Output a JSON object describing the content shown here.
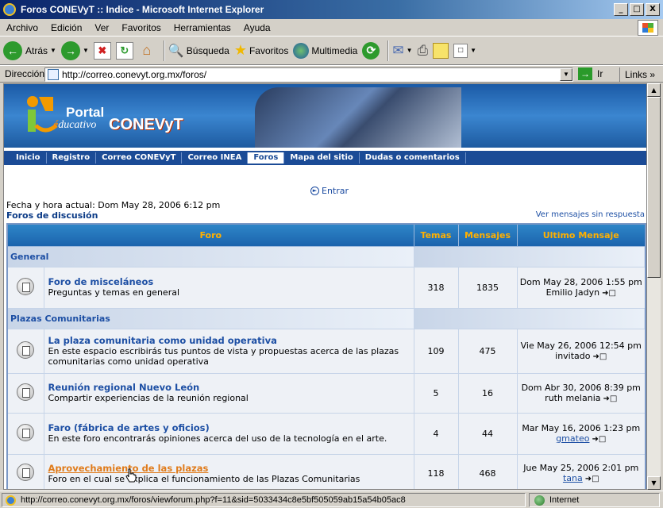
{
  "window": {
    "title": "Foros CONEVyT :: Indice - Microsoft Internet Explorer",
    "buttons": [
      "_",
      "□",
      "X"
    ]
  },
  "menu": [
    "Archivo",
    "Edición",
    "Ver",
    "Favoritos",
    "Herramientas",
    "Ayuda"
  ],
  "toolbar": {
    "back": "Atrás",
    "search": "Búsqueda",
    "favorites": "Favoritos",
    "media": "Multimedia"
  },
  "address": {
    "label": "Dirección",
    "url": "http://correo.conevyt.org.mx/foros/",
    "go": "Ir",
    "links": "Links"
  },
  "banner": {
    "portal": "Portal",
    "educativo": "ducativo",
    "brand": "CONEVyT"
  },
  "nav": [
    "Inicio",
    "Registro",
    "Correo CONEVyT",
    "Correo INEA",
    "Foros",
    "Mapa del sitio",
    "Dudas o comentarios"
  ],
  "page": {
    "entrar": "Entrar",
    "fecha": "Fecha y hora actual: Dom May 28, 2006 6:12 pm",
    "foros_link": "Foros de discusión",
    "unread_link": "Ver mensajes sin respuesta"
  },
  "table": {
    "headers": {
      "foro": "Foro",
      "temas": "Temas",
      "mensajes": "Mensajes",
      "ultimo": "Ultimo Mensaje"
    },
    "categories": [
      {
        "name": "General",
        "forums": [
          {
            "name": "Foro de misceláneos",
            "desc": "Preguntas y temas en general",
            "temas": "318",
            "mensajes": "1835",
            "date": "Dom May 28, 2006 1:55 pm",
            "user": "Emilio Jadyn"
          }
        ]
      },
      {
        "name": "Plazas Comunitarias",
        "forums": [
          {
            "name": "La plaza comunitaria como unidad operativa",
            "desc": "En este espacio escribirás tus puntos de vista y propuestas acerca de las plazas comunitarias como unidad operativa",
            "temas": "109",
            "mensajes": "475",
            "date": "Vie May 26, 2006 12:54 pm",
            "user": "invitado"
          },
          {
            "name": "Reunión regional Nuevo León",
            "desc": "Compartir experiencias de la reunión regional",
            "temas": "5",
            "mensajes": "16",
            "date": "Dom Abr 30, 2006 8:39 pm",
            "user": "ruth melania"
          },
          {
            "name": "Faro (fábrica de artes y oficios)",
            "desc": "En este foro encontrarás opiniones acerca del uso de la tecnología en el arte.",
            "temas": "4",
            "mensajes": "44",
            "date": "Mar May 16, 2006 1:23 pm",
            "user": "gmateo"
          },
          {
            "name": "Aprovechamiento de las plazas",
            "desc": "Foro en el cual se explica el funcionamiento de las Plazas Comunitarias",
            "temas": "118",
            "mensajes": "468",
            "date": "Jue May 25, 2006 2:01 pm",
            "user": "tana"
          }
        ]
      }
    ]
  },
  "status": {
    "url": "http://correo.conevyt.org.mx/foros/viewforum.php?f=11&sid=5033434c8e5bf505059ab15a54b05ac8",
    "zone": "Internet"
  },
  "colors": {
    "title_bar": "#0a246a",
    "nav_bg": "#1b4b96",
    "header_text": "#ffb000",
    "link": "#1d4fa4",
    "hover_link": "#e07b1a"
  }
}
